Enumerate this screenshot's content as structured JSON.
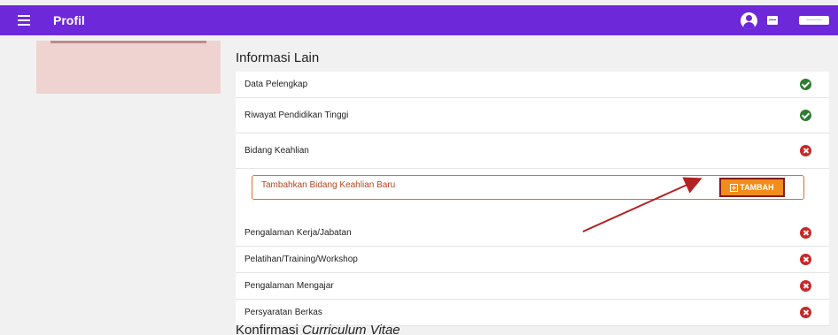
{
  "header": {
    "title": "Profil"
  },
  "sections": {
    "informasi_lain": "Informasi Lain",
    "konfirmasi_prefix": "Konfirmasi ",
    "konfirmasi_italic": "Curriculum Vitae"
  },
  "items": [
    {
      "label": "Data Pelengkap",
      "status": "complete"
    },
    {
      "label": "Riwayat Pendidikan Tinggi",
      "status": "complete"
    },
    {
      "label": "Bidang Keahlian",
      "status": "incomplete"
    },
    {
      "label": "Pengalaman Kerja/Jabatan",
      "status": "incomplete"
    },
    {
      "label": "Pelatihan/Training/Workshop",
      "status": "incomplete"
    },
    {
      "label": "Pengalaman Mengajar",
      "status": "incomplete"
    },
    {
      "label": "Persyaratan Berkas",
      "status": "incomplete"
    }
  ],
  "add_panel": {
    "label": "Tambahkan Bidang Keahlian Baru",
    "button": "TAMBAH"
  },
  "colors": {
    "topbar": "#6d28d9",
    "complete": "#2e7d32",
    "incomplete": "#c62828",
    "button": "#f28c1b",
    "arrow": "#b22222"
  },
  "icons": {
    "menu": "hamburger-menu-icon",
    "account": "account-circle-icon",
    "complete": "check-circle-icon",
    "incomplete": "x-circle-icon",
    "add": "plus-square-icon"
  }
}
